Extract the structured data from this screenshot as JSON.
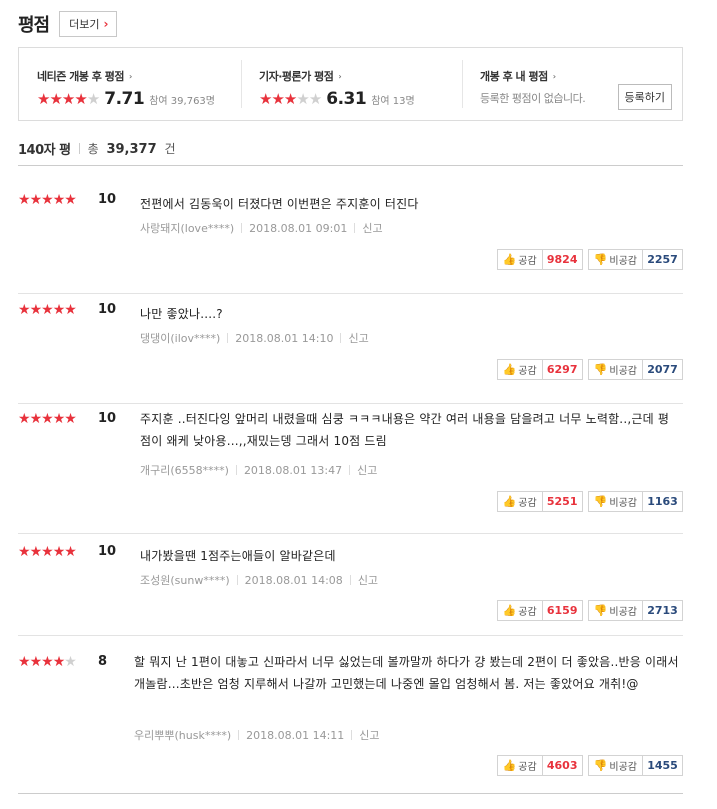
{
  "header": {
    "title": "평점",
    "more_label": "더보기",
    "more_chevron": "›"
  },
  "summary": [
    {
      "label": "네티즌 개봉 후 평점",
      "arrow": "›",
      "stars_on": 4,
      "stars_off": 1,
      "score": "7.71",
      "meta": "참여 39,763명"
    },
    {
      "label": "기자·평론가 평점",
      "arrow": "›",
      "stars_on": 3,
      "stars_off": 2,
      "score": "6.31",
      "meta": "참여 13명"
    },
    {
      "label": "개봉 후 내 평점",
      "arrow": "›",
      "empty_text": "등록한 평점이 없습니다.",
      "button_label": "등록하기"
    }
  ],
  "count": {
    "label": "140자 평",
    "total_prefix": "총",
    "total": "39,377",
    "total_suffix": "건"
  },
  "vote_labels": {
    "up": "공감",
    "down": "비공감"
  },
  "icons": {
    "up": "thumbs-up-icon",
    "down": "thumbs-down-icon",
    "star": "star-icon"
  },
  "colors": {
    "accent": "#e8323c",
    "down_count": "#2a4a7b"
  },
  "meta_report_label": "신고",
  "reviews": [
    {
      "stars_on": 5,
      "stars_off": 0,
      "score": "10",
      "text": "전편에서 김동욱이 터졌다면 이번편은 주지훈이 터진다",
      "author": "사랑돼지(love****)",
      "date": "2018.08.01 09:01",
      "up": "9824",
      "down": "2257"
    },
    {
      "stars_on": 5,
      "stars_off": 0,
      "score": "10",
      "text": "나만 좋았나....?",
      "author": "댕댕이(ilov****)",
      "date": "2018.08.01 14:10",
      "up": "6297",
      "down": "2077"
    },
    {
      "stars_on": 5,
      "stars_off": 0,
      "score": "10",
      "text": "주지훈 ..터진다잉 앞머리 내렸을때 심쿵 ㅋㅋㅋ내용은 약간 여러 내용을 담을려고 너무 노력함..,근데 평점이 왜케 낮아용...,,재밌는뎅 그래서 10점 드림",
      "author": "개구리(6558****)",
      "date": "2018.08.01 13:47",
      "up": "5251",
      "down": "1163"
    },
    {
      "stars_on": 5,
      "stars_off": 0,
      "score": "10",
      "text": "내가봤을땐 1점주는애들이 알바같은데",
      "author": "조성원(sunw****)",
      "date": "2018.08.01 14:08",
      "up": "6159",
      "down": "2713"
    },
    {
      "stars_on": 4,
      "stars_off": 1,
      "score": "8",
      "text": "할 뭐지 난 1편이 대놓고 신파라서 너무 싫었는데 볼까말까 하다가 걍 봤는데 2편이 더 좋았음..반응 이래서 개놀람...초반은 엄청 지루해서 나갈까 고민했는데 나중엔 몰입 엄청해서 봄. 저는 좋았어요 개취!@",
      "author": "우리뿌뿌(husk****)",
      "date": "2018.08.01 14:11",
      "up": "4603",
      "down": "1455"
    }
  ]
}
